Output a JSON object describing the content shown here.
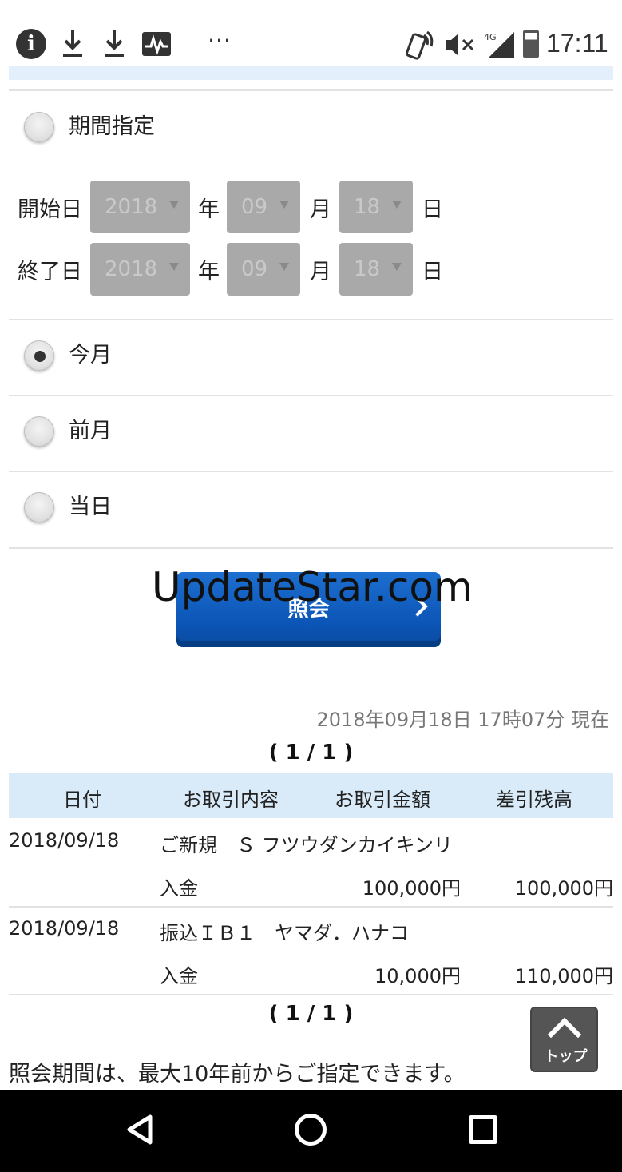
{
  "status_bar": {
    "time": "17:11",
    "network": "4G",
    "icons": [
      "info-icon",
      "download-icon",
      "download-icon",
      "pulse-icon",
      "more-icon",
      "nfc-vibrate-icon",
      "mute-icon",
      "signal-icon",
      "battery-icon"
    ],
    "more_glyph": "···"
  },
  "period_options": {
    "custom": {
      "label": "期間指定",
      "checked": false
    },
    "this_month": {
      "label": "今月",
      "checked": true
    },
    "last_month": {
      "label": "前月",
      "checked": false
    },
    "today": {
      "label": "当日",
      "checked": false
    }
  },
  "date_range": {
    "start": {
      "label": "開始日",
      "year": "2018",
      "month": "09",
      "day": "18"
    },
    "end": {
      "label": "終了日",
      "year": "2018",
      "month": "09",
      "day": "18"
    },
    "units": {
      "year": "年",
      "month": "月",
      "day": "日"
    }
  },
  "inquiry_button": {
    "label": "照会"
  },
  "watermark": "UpdateStar.com",
  "timestamp": "2018年09月18日 17時07分 現在",
  "pager": "( 1 / 1 )",
  "table": {
    "headers": [
      "日付",
      "お取引内容",
      "お取引金額",
      "差引残高"
    ],
    "rows": [
      {
        "date": "2018/09/18",
        "description": "ご新規　Ｓ フツウダンカイキンリ",
        "type": "入金",
        "amount": "100,000円",
        "balance": "100,000円"
      },
      {
        "date": "2018/09/18",
        "description": "振込ＩＢ１　ヤマダ．ハナコ",
        "type": "入金",
        "amount": "10,000円",
        "balance": "110,000円"
      }
    ]
  },
  "note": "照会期間は、最大10年前からご指定できます。",
  "top_button": {
    "label": "トップ"
  },
  "colors": {
    "primary_button": "#0b55b6",
    "table_header": "#d9ebf8",
    "band": "#e3f0fb"
  }
}
